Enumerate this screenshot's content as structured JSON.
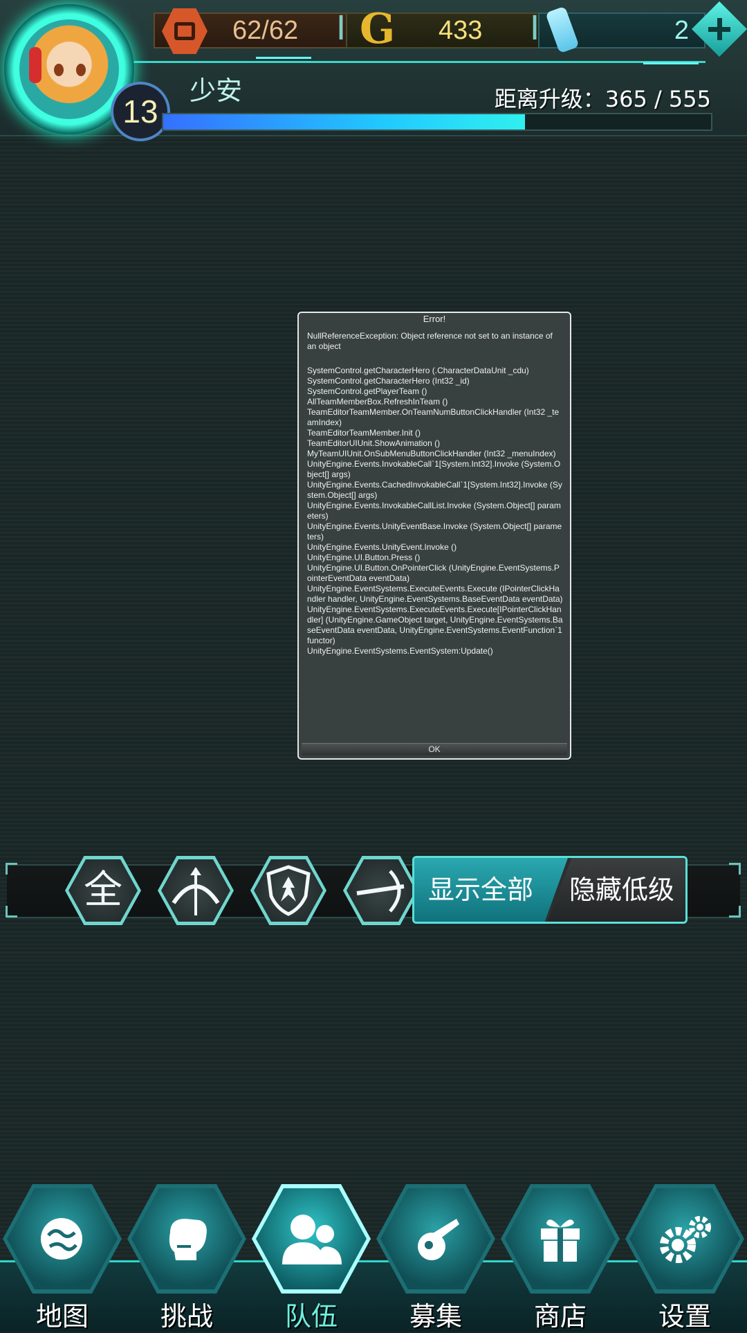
{
  "header": {
    "player_name": "少安",
    "level": "13",
    "exp_label": "距离升级：",
    "exp_value": "365 / 555",
    "exp_fraction": 0.66,
    "stamina": "62/62",
    "gold": "433",
    "gems": "2",
    "icons": {
      "avatar": "player-avatar",
      "stamina": "stamina-icon",
      "gold": "gold-coin-icon",
      "gems": "gem-bottle-icon",
      "add": "plus-icon"
    }
  },
  "error_dialog": {
    "title": "Error!",
    "message": "NullReferenceException: Object reference not set to an instance of an object",
    "stack_trace": "SystemControl.getCharacterHero (.CharacterDataUnit _cdu)\nSystemControl.getCharacterHero (Int32 _id)\nSystemControl.getPlayerTeam ()\nAllTeamMemberBox.RefreshInTeam ()\nTeamEditorTeamMember.OnTeamNumButtonClickHandler (Int32 _teamIndex)\nTeamEditorTeamMember.Init ()\nTeamEditorUIUnit.ShowAnimation ()\nMyTeamUIUnit.OnSubMenuButtonClickHandler (Int32 _menuIndex)\nUnityEngine.Events.InvokableCall`1[System.Int32].Invoke (System.Object[] args)\nUnityEngine.Events.CachedInvokableCall`1[System.Int32].Invoke (System.Object[] args)\nUnityEngine.Events.InvokableCallList.Invoke (System.Object[] parameters)\nUnityEngine.Events.UnityEventBase.Invoke (System.Object[] parameters)\nUnityEngine.Events.UnityEvent.Invoke ()\nUnityEngine.UI.Button.Press ()\nUnityEngine.UI.Button.OnPointerClick (UnityEngine.EventSystems.PointerEventData eventData)\nUnityEngine.EventSystems.ExecuteEvents.Execute (IPointerClickHandler handler, UnityEngine.EventSystems.BaseEventData eventData)\nUnityEngine.EventSystems.ExecuteEvents.Execute[IPointerClickHandler] (UnityEngine.GameObject target, UnityEngine.EventSystems.BaseEventData eventData, UnityEngine.EventSystems.EventFunction`1 functor)\nUnityEngine.EventSystems.EventSystem:Update()",
    "ok_label": "OK"
  },
  "filter": {
    "buttons": [
      {
        "label": "全",
        "icon": "all-filter-icon"
      },
      {
        "label": "",
        "icon": "bow-icon"
      },
      {
        "label": "",
        "icon": "shield-icon"
      },
      {
        "label": "",
        "icon": "crossbow-icon"
      }
    ],
    "show_all_label": "显示全部",
    "hide_low_label": "隐藏低级",
    "selected": "显示全部"
  },
  "nav": {
    "items": [
      {
        "label": "地图",
        "icon": "map-icon"
      },
      {
        "label": "挑战",
        "icon": "boxing-glove-icon"
      },
      {
        "label": "队伍",
        "icon": "team-icon",
        "active": true
      },
      {
        "label": "募集",
        "icon": "recruit-icon"
      },
      {
        "label": "商店",
        "icon": "gift-icon"
      },
      {
        "label": "设置",
        "icon": "gear-icon"
      }
    ]
  },
  "colors": {
    "accent": "#2dd7cb",
    "active_label": "#6ff0e0",
    "exp_bar": "#21c8ff"
  }
}
